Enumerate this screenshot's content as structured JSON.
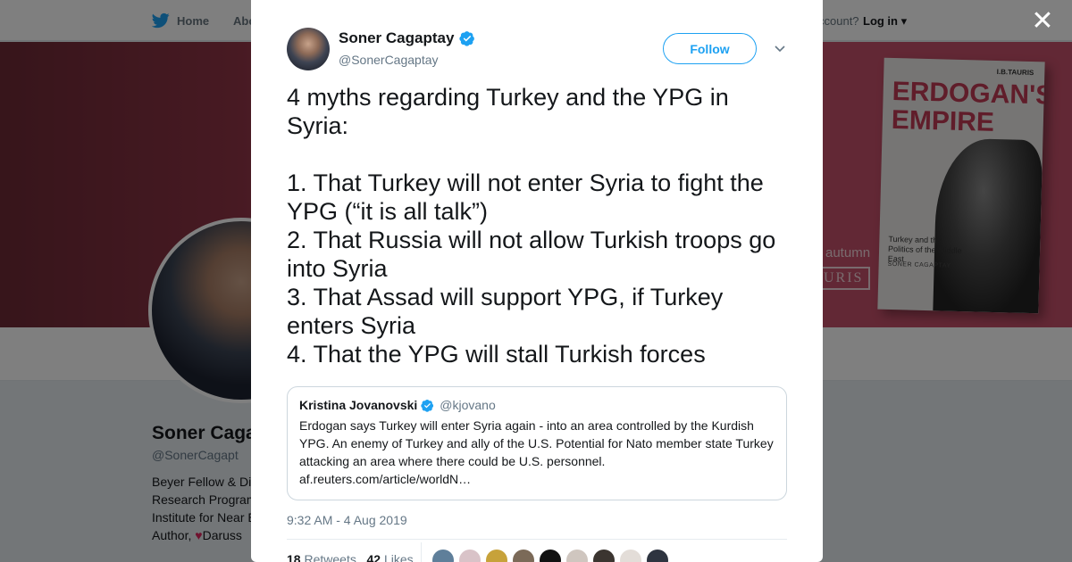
{
  "topbar": {
    "home_label": "Home",
    "about_label": "Abo",
    "account_label": "ccount?",
    "login_label": "Log in"
  },
  "banner": {
    "autumn_text": "autumn",
    "tauris_text": "URIS",
    "book": {
      "publisher": "I.B.TAURIS",
      "title": "ERDOGAN'S EMPIRE",
      "subtitle": "Turkey and the Politics of the Middle East",
      "author": "SONER CAGAPTAY"
    }
  },
  "profile": {
    "name": "Soner Caga",
    "handle": "@SonerCagapt",
    "bio_lines": [
      "Beyer Fellow & Di",
      "Research Program",
      "Institute for Near E",
      "Author,",
      "Daruss"
    ]
  },
  "tweet": {
    "author_name": "Soner Cagaptay",
    "author_handle": "@SonerCagaptay",
    "follow_label": "Follow",
    "text_lines": [
      "4 myths regarding Turkey and the YPG in Syria:",
      "1.  That Turkey will not enter Syria to fight the YPG (“it is all talk”)",
      "2. That Russia will not allow Turkish troops go into Syria",
      "3. That Assad will support YPG, if Turkey enters Syria",
      "4. That the YPG will stall Turkish forces"
    ],
    "quoted": {
      "author_name": "Kristina Jovanovski",
      "author_handle": "@kjovano",
      "text": "Erdogan says Turkey will enter Syria again - into an area controlled by the Kurdish YPG. An enemy of Turkey and ally of the U.S. Potential for Nato member state Turkey attacking an area where there could be U.S. personnel. af.reuters.com/article/worldN…"
    },
    "timestamp": "9:32 AM - 4 Aug 2019",
    "retweets_count": "18",
    "retweets_label": "Retweets",
    "likes_count": "42",
    "likes_label": "Likes"
  },
  "colors": {
    "brand_blue": "#1da1f2",
    "banner_red": "#c5506a",
    "text_primary": "#14171a",
    "text_secondary": "#657786"
  },
  "icons": {
    "twitter": "twitter-bird-icon",
    "verified": "verified-badge-icon",
    "close": "close-icon",
    "caret": "chevron-down-icon",
    "heart": "heart-icon"
  }
}
